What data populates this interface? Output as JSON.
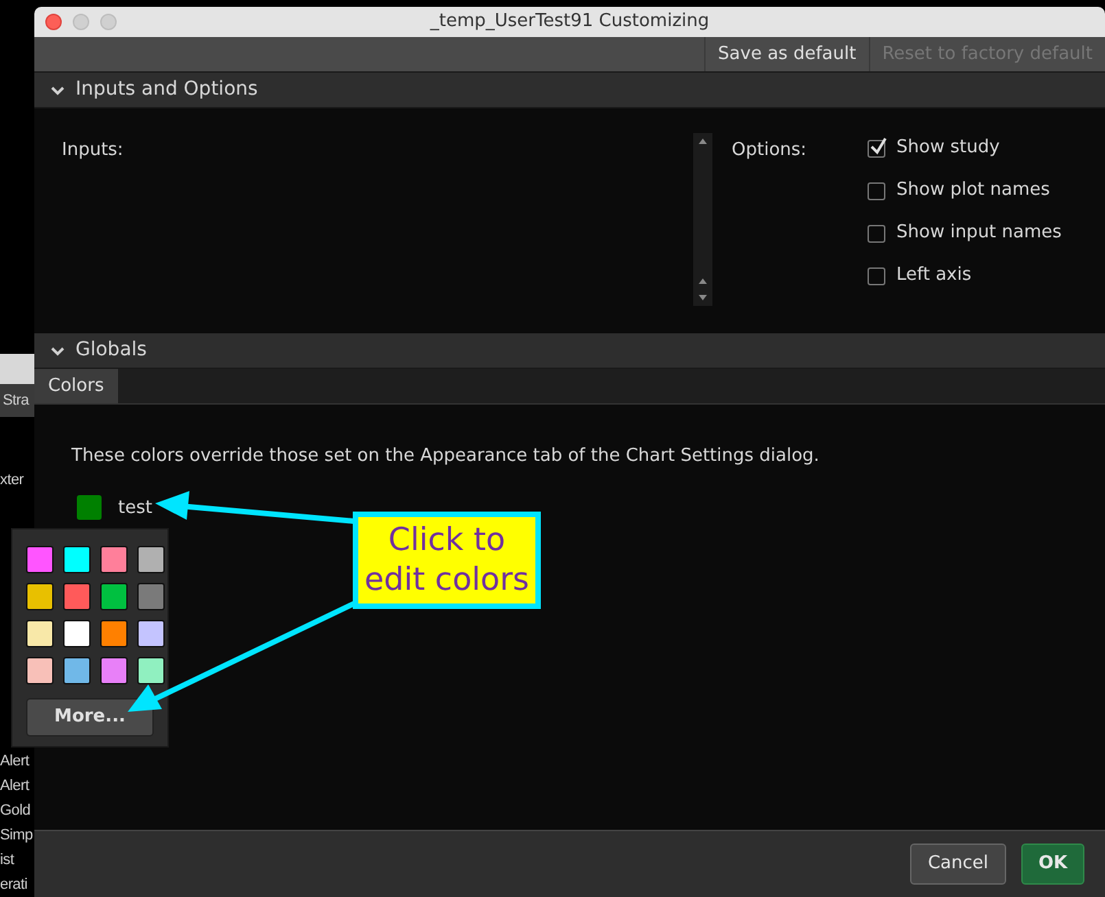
{
  "background_window": {
    "tab": "Stra",
    "rows_top": [
      "xter"
    ],
    "rows_bottom": [
      "Alert",
      "Alert",
      "Gold",
      "Simp",
      "ist",
      "erati"
    ]
  },
  "window": {
    "title": "_temp_UserTest91 Customizing"
  },
  "toolbar": [
    {
      "label": "Save as default",
      "disabled": false
    },
    {
      "label": "Reset to factory default",
      "disabled": true
    }
  ],
  "inputs_section": {
    "title": "Inputs and Options",
    "expanded": true,
    "inputs_label": "Inputs:",
    "options_label": "Options:",
    "options": [
      {
        "label": "Show study",
        "checked": true
      },
      {
        "label": "Show plot names",
        "checked": false
      },
      {
        "label": "Show input names",
        "checked": false
      },
      {
        "label": "Left axis",
        "checked": false
      }
    ]
  },
  "globals_section": {
    "title": "Globals",
    "expanded": true,
    "tabs": [
      {
        "label": "Colors",
        "selected": true
      }
    ],
    "description": "These colors override those set on the Appearance tab of the Chart Settings dialog.",
    "colors": [
      {
        "label": "test",
        "color": "#008000"
      }
    ]
  },
  "color_popup": {
    "swatches": [
      {
        "color": "#ff55ff"
      },
      {
        "color": "#00ffff"
      },
      {
        "color": "#ff7f9a"
      },
      {
        "color": "#b0b0b0"
      },
      {
        "color": "#e8c000"
      },
      {
        "color": "#ff5a5a"
      },
      {
        "color": "#00c040"
      },
      {
        "color": "#7a7a7a"
      },
      {
        "color": "#f8e8a8"
      },
      {
        "color": "#ffffff"
      },
      {
        "color": "#ff8000"
      },
      {
        "color": "#c4c4ff"
      },
      {
        "color": "#f8c0b8"
      },
      {
        "color": "#70b8e8"
      },
      {
        "color": "#e880f8"
      },
      {
        "color": "#90f0c0"
      }
    ],
    "more_button": "More..."
  },
  "callout": {
    "text": "Click to edit colors"
  },
  "footer": {
    "buttons": [
      {
        "label": "Cancel",
        "kind": "secondary"
      },
      {
        "label": "OK",
        "kind": "primary"
      }
    ]
  }
}
